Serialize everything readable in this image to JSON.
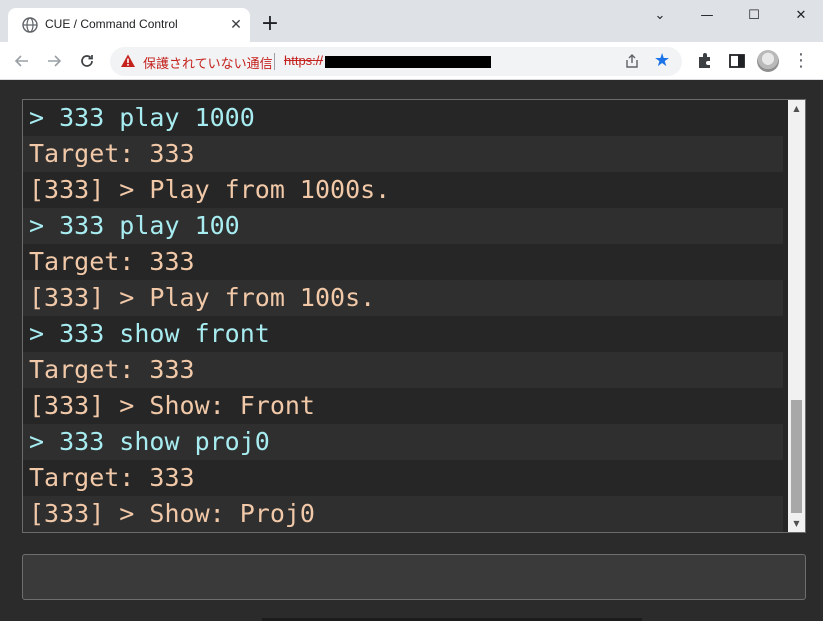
{
  "browser": {
    "tab_title": "CUE / Command Control",
    "tab_close": "✕",
    "new_tab": "+",
    "window": {
      "minimize": "⌄",
      "min": "—",
      "max": "☐",
      "close": "✕"
    },
    "security_warning": "保護されていない通信",
    "url_scheme": "https://"
  },
  "icons": {
    "favicon": "globe-icon",
    "warning": "warning-icon",
    "share": "share-icon",
    "bookmark": "star-icon",
    "extensions": "puzzle-icon",
    "sidepanel": "side-panel-icon",
    "menu": "kebab-menu-icon"
  },
  "colors": {
    "command": "#a7ecf0",
    "output": "#f2c9a8",
    "background": "#262626",
    "warning": "#c5221f",
    "bookmark": "#1a73e8"
  },
  "console": {
    "lines": [
      {
        "text": "> 333 play 1000",
        "kind": "cmd"
      },
      {
        "text": "Target: 333",
        "kind": "out"
      },
      {
        "text": "[333] > Play from 1000s.",
        "kind": "out"
      },
      {
        "text": "> 333 play 100",
        "kind": "cmd"
      },
      {
        "text": "Target: 333",
        "kind": "out"
      },
      {
        "text": "[333] > Play from 100s.",
        "kind": "out"
      },
      {
        "text": "> 333 show front",
        "kind": "cmd"
      },
      {
        "text": "Target: 333",
        "kind": "out"
      },
      {
        "text": "[333] > Show: Front",
        "kind": "out"
      },
      {
        "text": "> 333 show proj0",
        "kind": "cmd"
      },
      {
        "text": "Target: 333",
        "kind": "out"
      },
      {
        "text": "[333] > Show: Proj0",
        "kind": "out"
      }
    ]
  },
  "command_input": {
    "value": "",
    "placeholder": ""
  }
}
